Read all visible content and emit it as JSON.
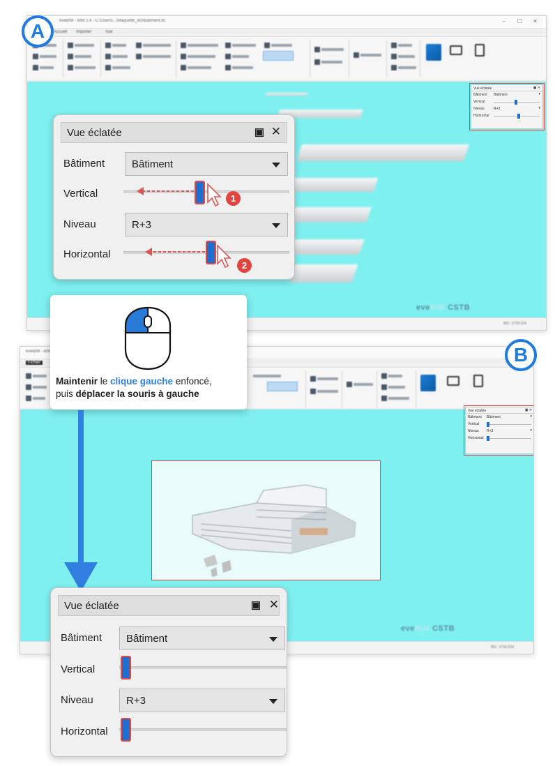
{
  "callouts": {
    "label_a": "A",
    "label_b": "B",
    "step_1": "1",
    "step_2": "2"
  },
  "app": {
    "window_title": "eveBIM - BIM 2.4 - C:\\Users\\...\\Maquette_ecl\\Batiment.ifc",
    "tabs": [
      "Fichier",
      "Accueil",
      "Importer",
      "Vue"
    ],
    "viewport_logo_left": "eve",
    "viewport_logo_mid": "BIM",
    "viewport_logo_right": "CSTB"
  },
  "panel_a": {
    "title": "Vue éclatée",
    "batiment_label": "Bâtiment",
    "batiment_value": "Bâtiment",
    "vertical_label": "Vertical",
    "niveau_label": "Niveau",
    "niveau_value": "R+3",
    "horizontal_label": "Horizontal",
    "vertical_level": 0.48,
    "horizontal_level": 0.53
  },
  "panel_b": {
    "title": "Vue éclatée",
    "batiment_label": "Bâtiment",
    "batiment_value": "Bâtiment",
    "vertical_label": "Vertical",
    "niveau_label": "Niveau",
    "niveau_value": "R+3",
    "horizontal_label": "Horizontal",
    "vertical_level": 0.0,
    "horizontal_level": 0.0
  },
  "mini_panel": {
    "title": "Vue éclatée",
    "batiment_label": "Bâtiment",
    "batiment_value": "Bâtiment",
    "vertical_label": "Vertical",
    "niveau_label": "Niveau",
    "niveau_value": "R+3",
    "horizontal_label": "Horizontal"
  },
  "tip": {
    "bold_1": "Maintenir",
    "text_1": " le ",
    "blue_1": "clique gauche",
    "text_2": " enfoncé,",
    "text_3": "puis ",
    "bold_2": "déplacer la souris à gauche"
  },
  "colors": {
    "viewport": "#7ff0f0",
    "accent_blue": "#1f6fd0",
    "highlight_red": "#e04848"
  }
}
